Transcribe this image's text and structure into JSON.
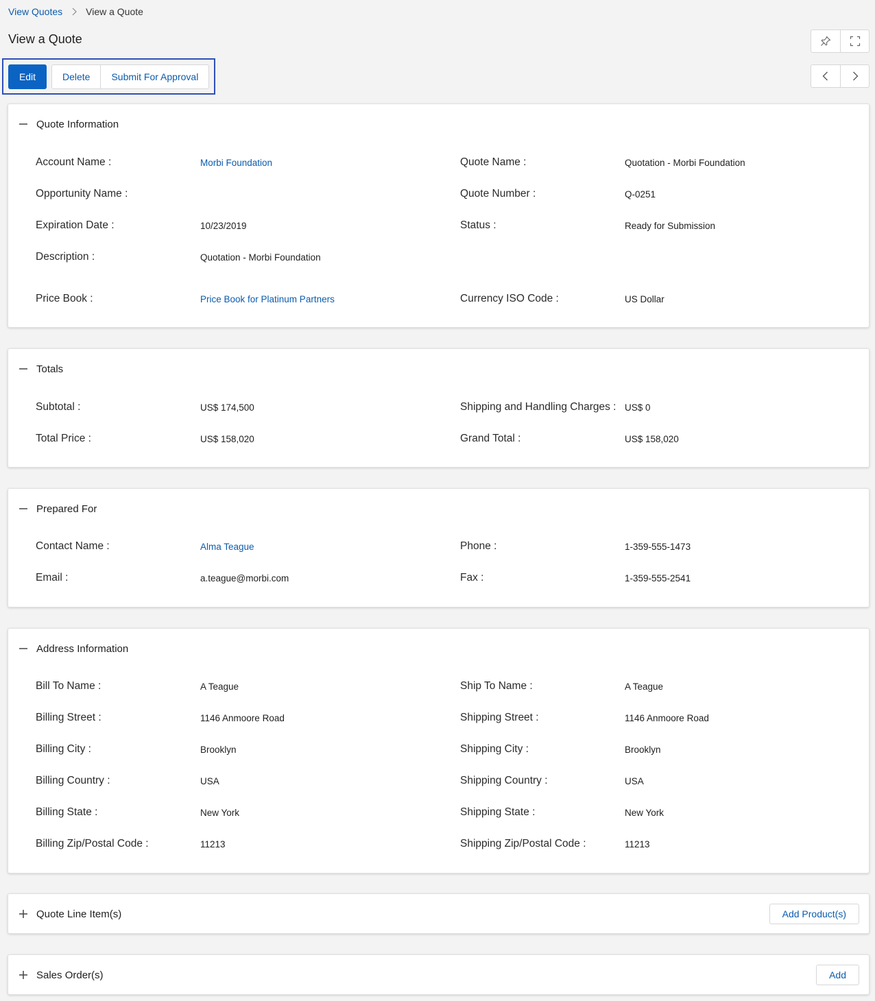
{
  "breadcrumb": {
    "parent": "View Quotes",
    "current": "View a Quote"
  },
  "page": {
    "title": "View a Quote"
  },
  "actions": {
    "edit": "Edit",
    "delete": "Delete",
    "submit": "Submit For Approval"
  },
  "icons": {
    "pin": "pin-icon",
    "fullscreen": "fullscreen-icon",
    "prev": "chevron-left-icon",
    "next": "chevron-right-icon",
    "collapse": "minus-icon",
    "expand": "plus-icon"
  },
  "colors": {
    "accent": "#0b63c3",
    "link": "#0b5cad",
    "focus_outline": "#2f4fb8"
  },
  "sections": {
    "quote_info": {
      "title": "Quote Information",
      "account_name_label": "Account Name :",
      "account_name": "Morbi Foundation",
      "quote_name_label": "Quote Name :",
      "quote_name": "Quotation - Morbi Foundation",
      "opportunity_name_label": "Opportunity Name :",
      "quote_number_label": "Quote Number :",
      "quote_number": "Q-0251",
      "expiration_date_label": "Expiration Date :",
      "expiration_date": "10/23/2019",
      "status_label": "Status :",
      "status": "Ready for Submission",
      "description_label": "Description :",
      "description": "Quotation - Morbi Foundation",
      "price_book_label": "Price Book :",
      "price_book": "Price Book for Platinum Partners",
      "currency_label": "Currency ISO Code :",
      "currency": "US Dollar"
    },
    "totals": {
      "title": "Totals",
      "subtotal_label": "Subtotal :",
      "subtotal": "US$ 174,500",
      "shipping_label": "Shipping and Handling Charges :",
      "shipping": "US$ 0",
      "total_price_label": "Total Price :",
      "total_price": "US$ 158,020",
      "grand_total_label": "Grand Total :",
      "grand_total": "US$ 158,020"
    },
    "prepared_for": {
      "title": "Prepared For",
      "contact_label": "Contact Name :",
      "contact": "Alma Teague",
      "phone_label": "Phone :",
      "phone": "1-359-555-1473",
      "email_label": "Email :",
      "email": "a.teague@morbi.com",
      "fax_label": "Fax :",
      "fax": "1-359-555-2541"
    },
    "address": {
      "title": "Address Information",
      "bill_to_label": "Bill To Name :",
      "bill_to": "A Teague",
      "ship_to_label": "Ship To Name :",
      "ship_to": "A Teague",
      "billing_street_label": "Billing Street :",
      "billing_street": "1146 Anmoore Road",
      "shipping_street_label": "Shipping Street :",
      "shipping_street": "1146 Anmoore Road",
      "billing_city_label": "Billing City :",
      "billing_city": "Brooklyn",
      "shipping_city_label": "Shipping City :",
      "shipping_city": "Brooklyn",
      "billing_country_label": "Billing Country :",
      "billing_country": "USA",
      "shipping_country_label": "Shipping Country :",
      "shipping_country": "USA",
      "billing_state_label": "Billing State :",
      "billing_state": "New York",
      "shipping_state_label": "Shipping State :",
      "shipping_state": "New York",
      "billing_zip_label": "Billing Zip/Postal Code :",
      "billing_zip": "11213",
      "shipping_zip_label": "Shipping Zip/Postal Code :",
      "shipping_zip": "11213"
    },
    "line_items": {
      "title": "Quote Line Item(s)",
      "add_label": "Add Product(s)"
    },
    "sales_orders": {
      "title": "Sales Order(s)",
      "add_label": "Add"
    }
  }
}
